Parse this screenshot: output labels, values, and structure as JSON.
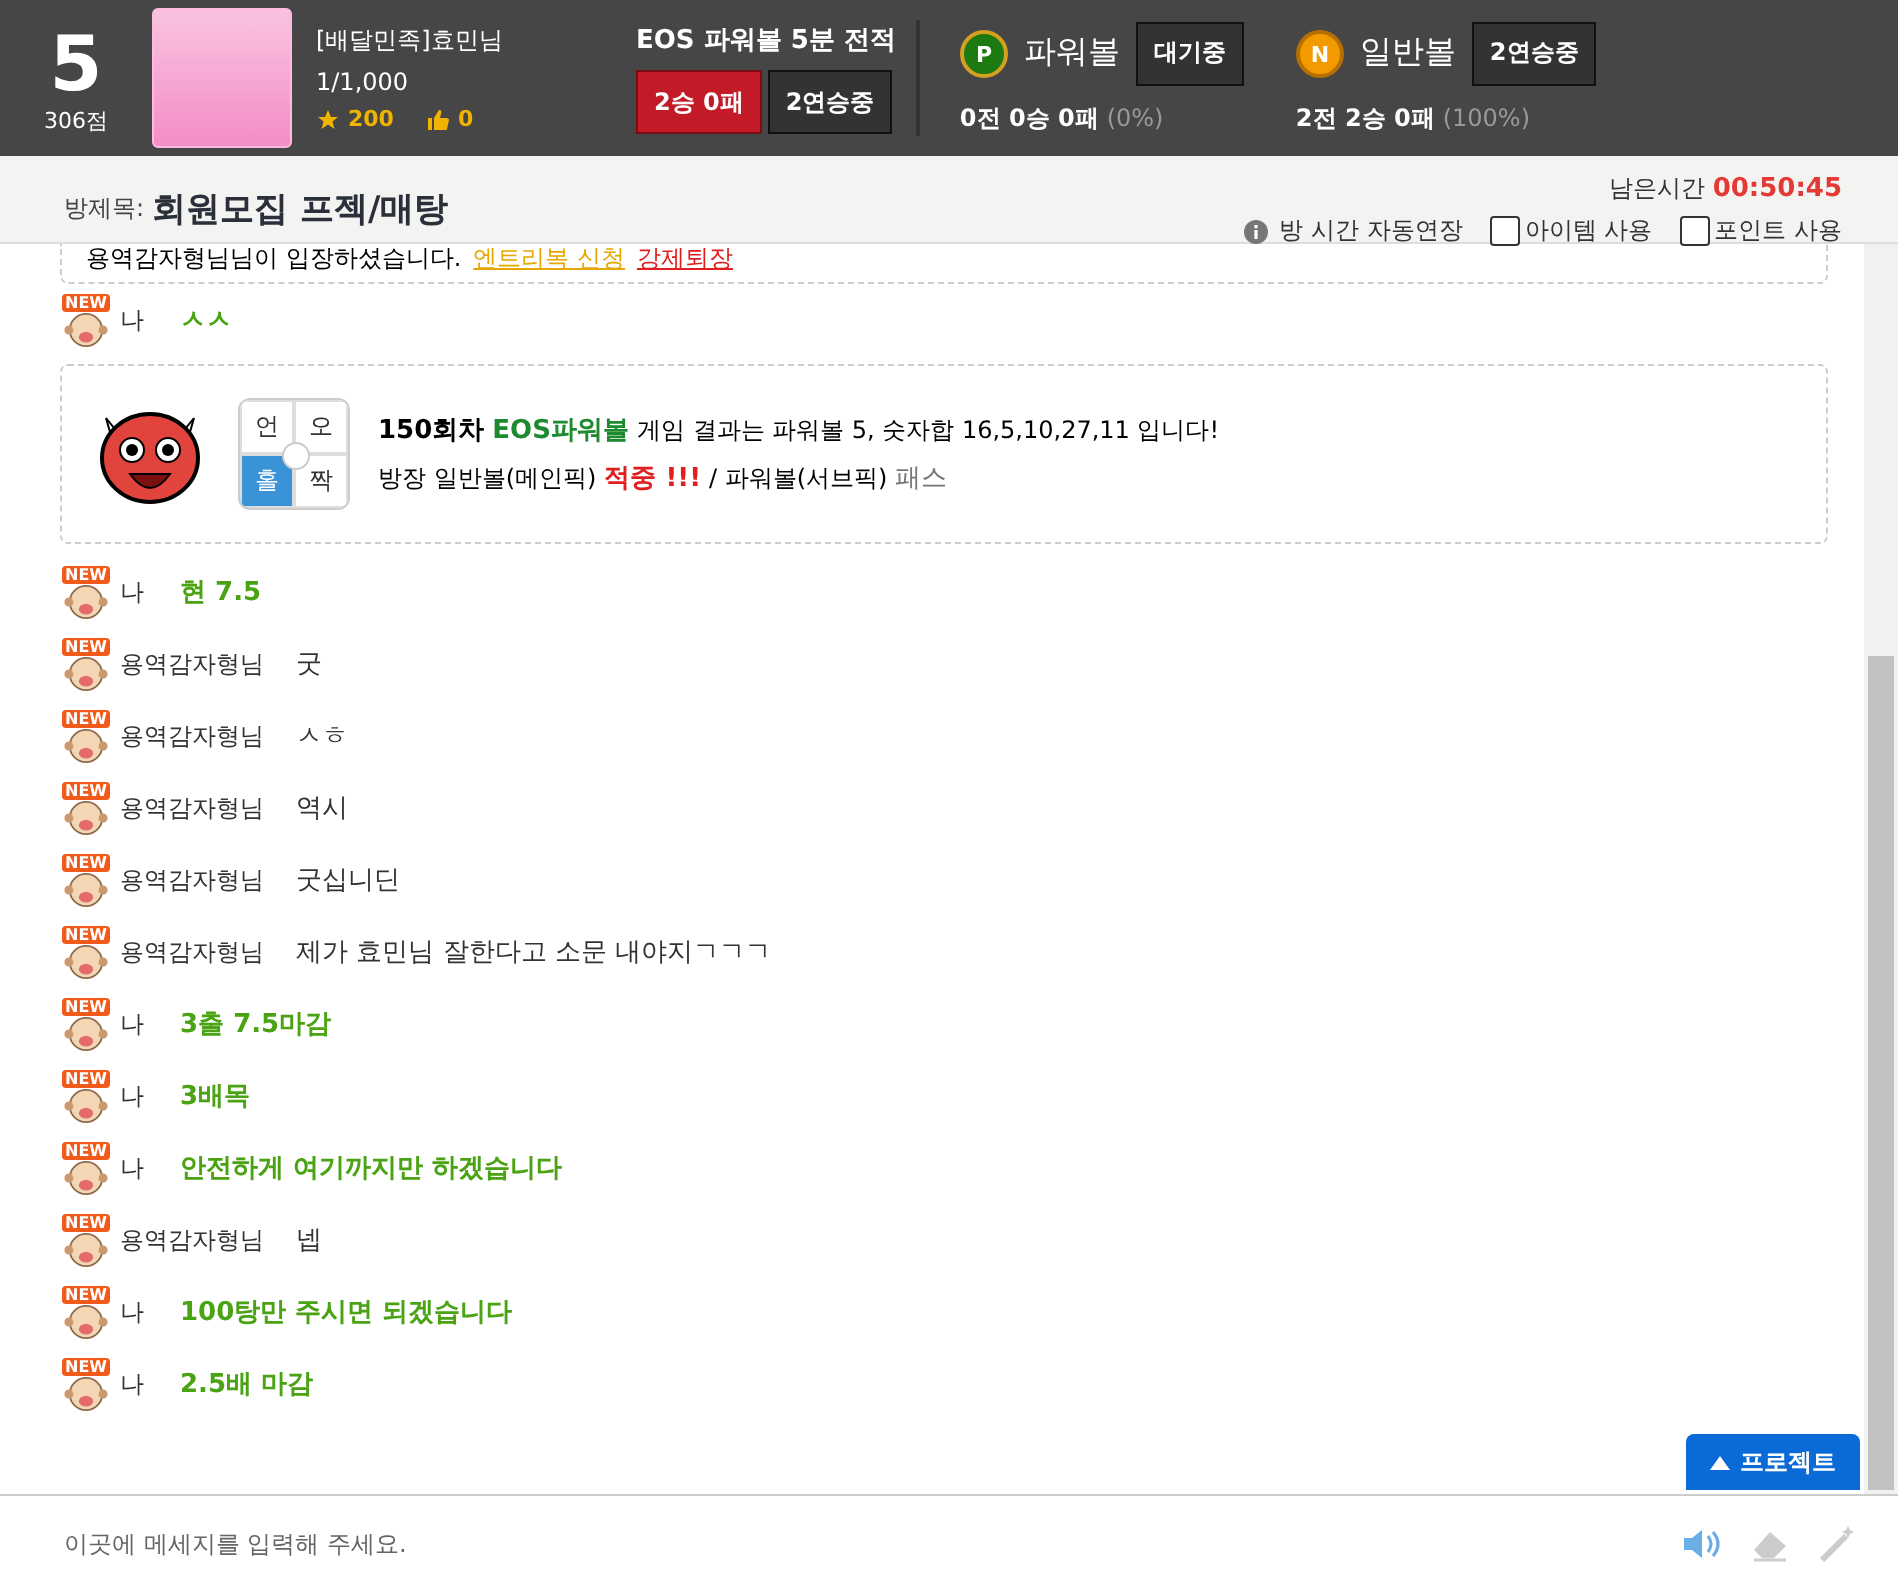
{
  "header": {
    "rank": "5",
    "score": "306점",
    "profile": {
      "name": "[배달민족]효민님",
      "record": "1/1,000",
      "stars": "200",
      "likes": "0"
    },
    "eos": {
      "title": "EOS 파워볼 5분 전적",
      "result": "2승 0패",
      "streak": "2연승중"
    },
    "balls": [
      {
        "kind": "power",
        "badge": "P",
        "label": "파워볼",
        "status": "대기중",
        "summary": "0전 0승 0패",
        "percent": "(0%)"
      },
      {
        "kind": "normal",
        "badge": "N",
        "label": "일반볼",
        "status": "2연승중",
        "summary": "2전 2승 0패",
        "percent": "(100%)"
      }
    ]
  },
  "room": {
    "title_label": "방제목:",
    "title": "회원모집 프젝/매탕",
    "remaining_label": "남은시간",
    "remaining": "00:50:45",
    "auto_extend": "방 시간 자동연장",
    "options": [
      {
        "label": "아이템 사용",
        "checked": false
      },
      {
        "label": "포인트 사용",
        "checked": false
      }
    ]
  },
  "chat": [
    {
      "kind": "notice",
      "text": "용역감자형님님이 입장하셨습니다.",
      "links": [
        "엔트리복 신청",
        "강제퇴장"
      ]
    },
    {
      "kind": "mine",
      "badge": "NEW",
      "sender": "나",
      "text": "ㅅㅅ"
    },
    {
      "kind": "result",
      "round": "150회차",
      "game": "EOS파워볼",
      "line1": "게임 결과는 파워볼 5, 숫자합 16,5,10,27,11 입니다!",
      "line2": "방장 일반볼(메인픽)",
      "hit": "적중 !!!",
      "line3": "/ 파워볼(서브픽)",
      "pass": "패스",
      "cells": [
        {
          "label": "언",
          "selected": false
        },
        {
          "label": "오",
          "selected": false
        },
        {
          "label": "홀",
          "selected": true
        },
        {
          "label": "짝",
          "selected": false
        }
      ]
    },
    {
      "kind": "mine",
      "badge": "NEW",
      "sender": "나",
      "text": "현 7.5"
    },
    {
      "kind": "other",
      "badge": "NEW",
      "sender": "용역감자형님",
      "text": "굿"
    },
    {
      "kind": "other",
      "badge": "NEW",
      "sender": "용역감자형님",
      "text": "ㅅㅎ"
    },
    {
      "kind": "other",
      "badge": "NEW",
      "sender": "용역감자형님",
      "text": "역시"
    },
    {
      "kind": "other",
      "badge": "NEW",
      "sender": "용역감자형님",
      "text": "굿십니딘"
    },
    {
      "kind": "other",
      "badge": "NEW",
      "sender": "용역감자형님",
      "text": "제가 효민님 잘한다고 소문 내야지ㄱㄱㄱ"
    },
    {
      "kind": "mine",
      "badge": "NEW",
      "sender": "나",
      "text": "3출 7.5마감"
    },
    {
      "kind": "mine",
      "badge": "NEW",
      "sender": "나",
      "text": "3배목"
    },
    {
      "kind": "mine",
      "badge": "NEW",
      "sender": "나",
      "text": "안전하게 여기까지만 하겠습니다"
    },
    {
      "kind": "other",
      "badge": "NEW",
      "sender": "용역감자형님",
      "text": "넵"
    },
    {
      "kind": "mine",
      "badge": "NEW",
      "sender": "나",
      "text": "100탕만 주시면 되겠습니다"
    },
    {
      "kind": "mine",
      "badge": "NEW",
      "sender": "나",
      "text": "2.5배 마감"
    }
  ],
  "project_button": "프로젝트",
  "input": {
    "placeholder": "이곳에 메세지를 입력해 주세요."
  }
}
